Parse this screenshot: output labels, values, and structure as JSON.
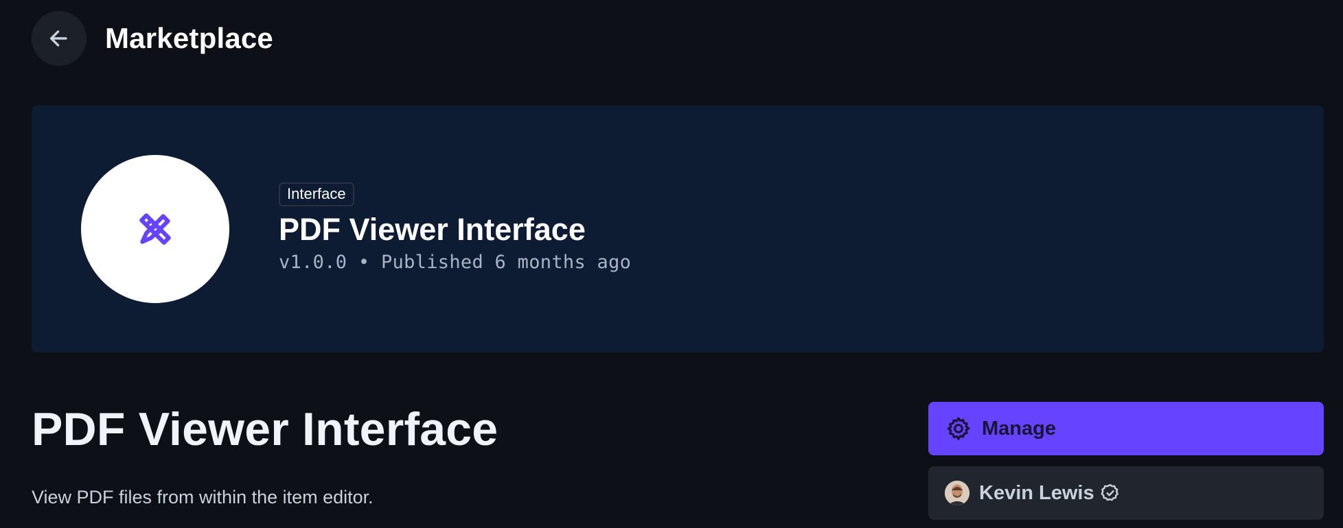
{
  "header": {
    "title": "Marketplace",
    "back_icon": "arrow-left-icon"
  },
  "banner": {
    "logo_icon": "ruler-pencil-icon",
    "type_badge": "Interface",
    "title": "PDF Viewer Interface",
    "meta": "v1.0.0 • Published 6 months ago"
  },
  "main": {
    "title": "PDF Viewer Interface",
    "description": "View PDF files from within the item editor."
  },
  "sidebar": {
    "manage_label": "Manage",
    "manage_icon": "gear-icon",
    "author_name": "Kevin Lewis",
    "verified_icon": "verified-badge-icon"
  },
  "colors": {
    "background": "#0d1117",
    "banner": "#0e1c33",
    "accent": "#6644ff",
    "card": "#21262e"
  }
}
